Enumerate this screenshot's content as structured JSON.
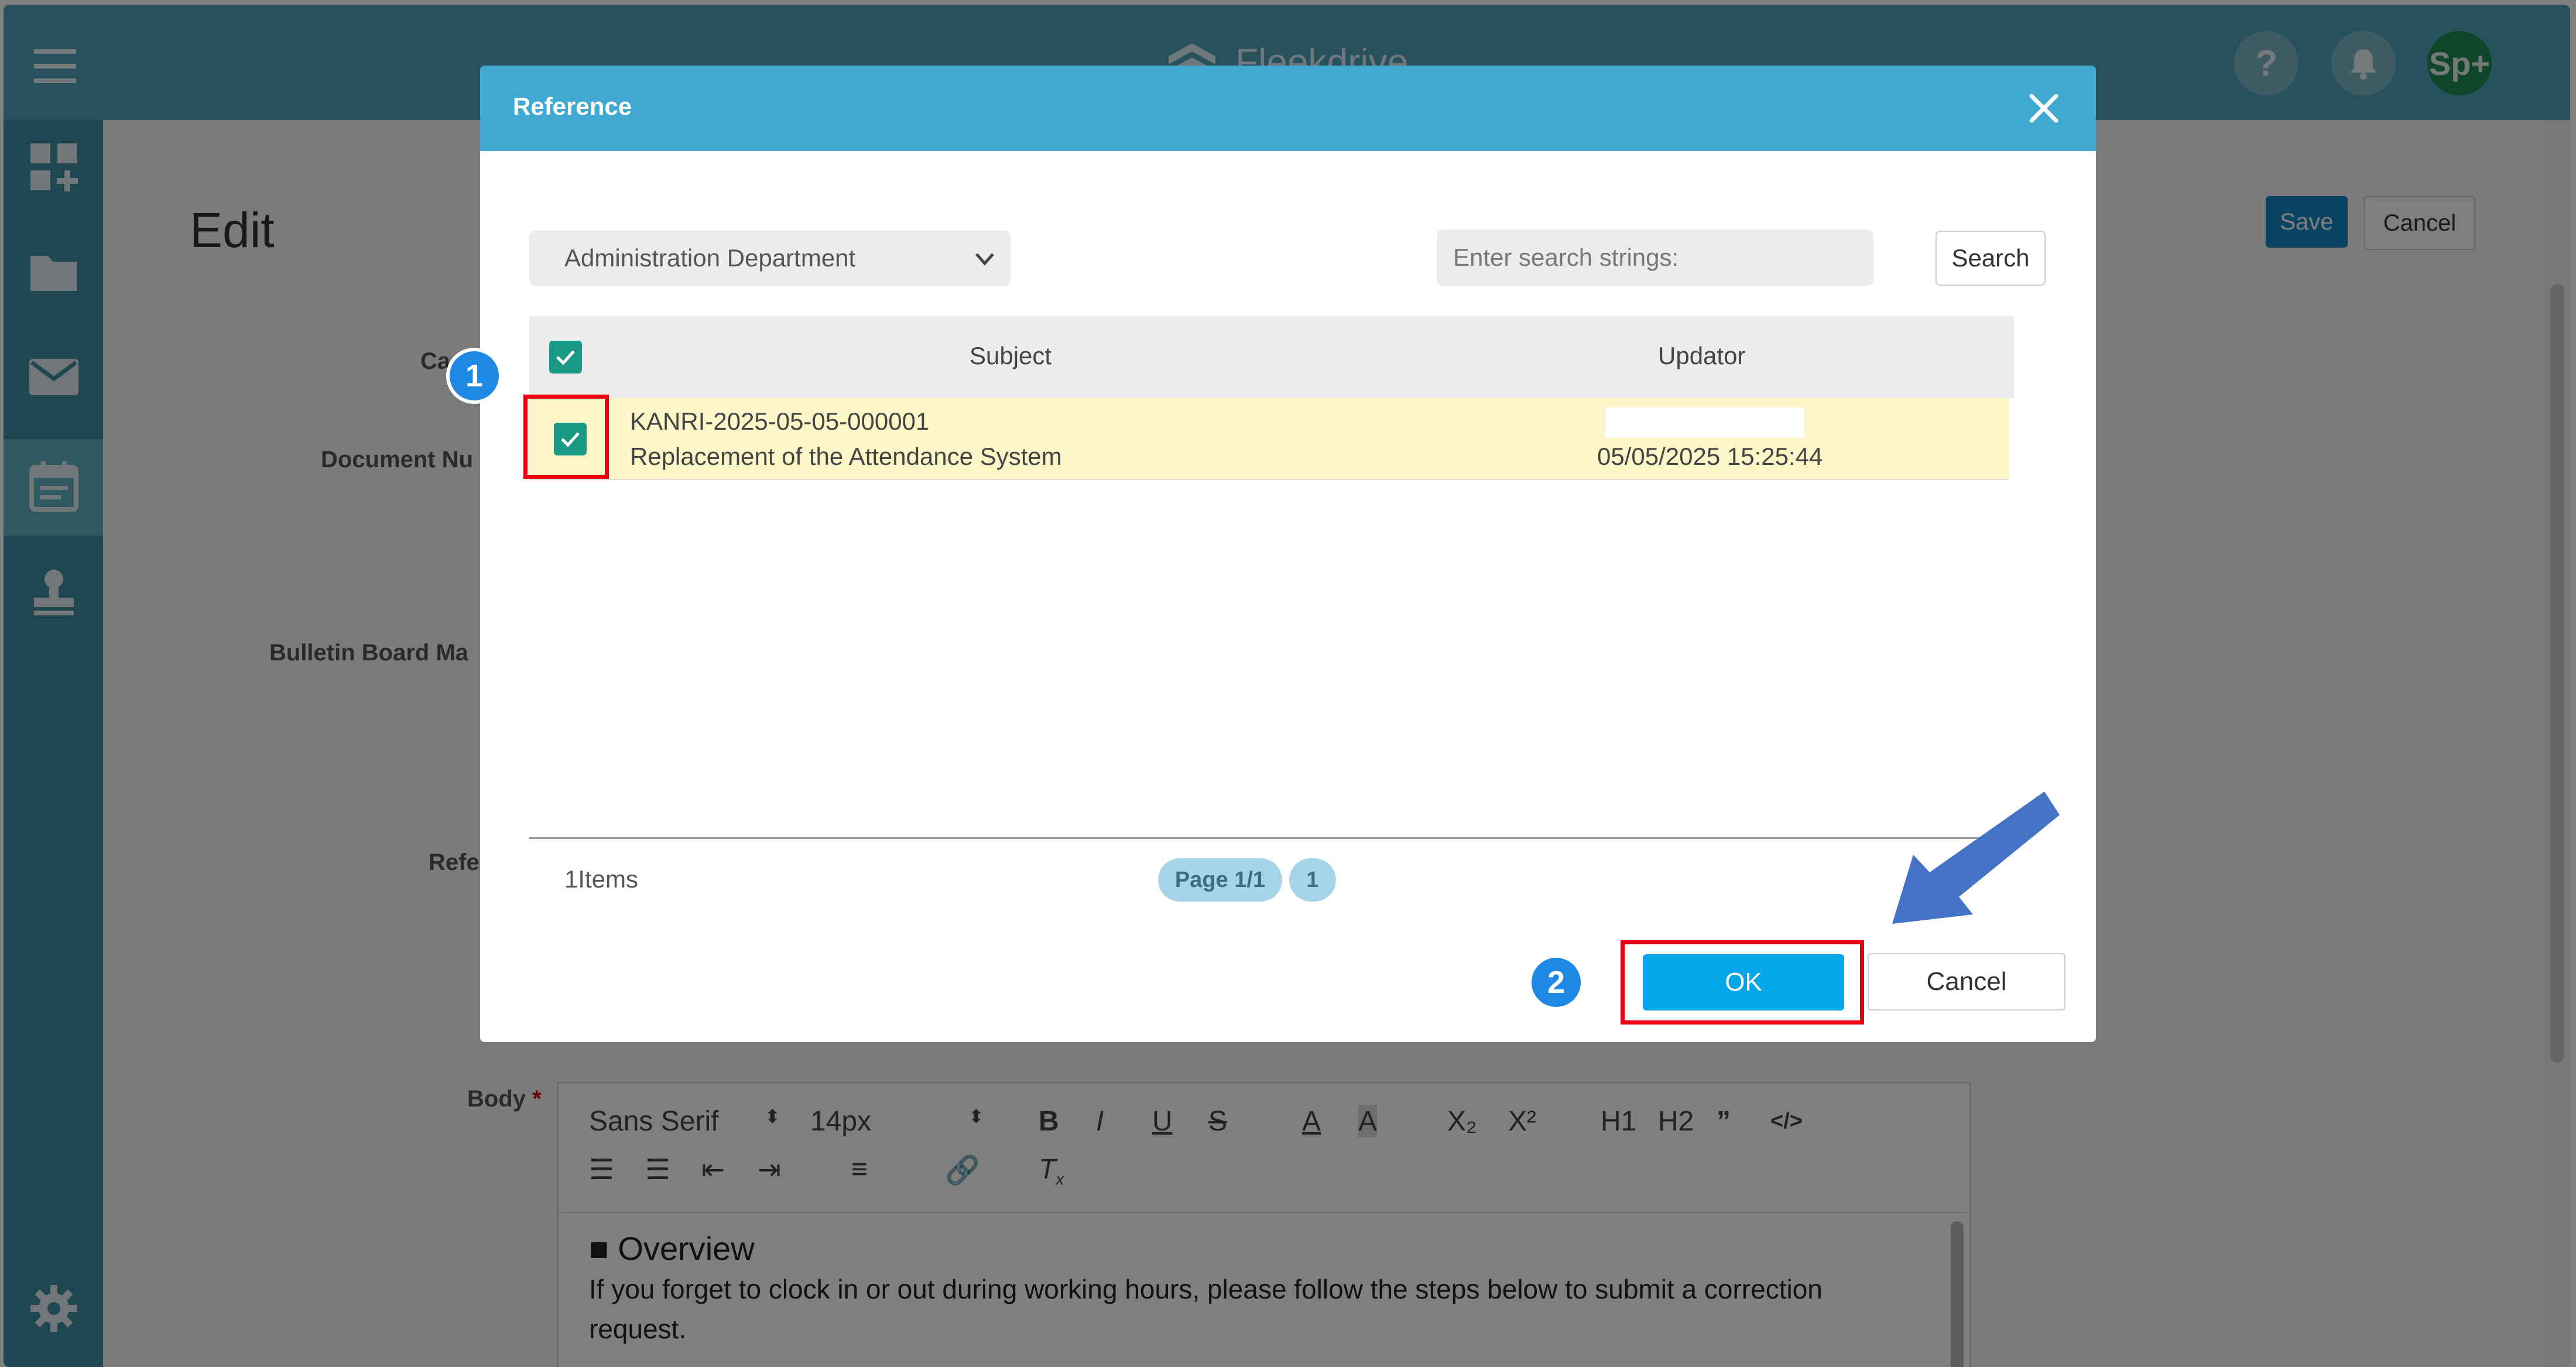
{
  "app": {
    "brand": "Fleekdrive",
    "avatar_text": "Sp+",
    "help_glyph": "?",
    "page_title": "Edit",
    "save_label": "Save",
    "cancel_label": "Cancel",
    "field_labels": [
      "Ca",
      "Document Nu",
      "Bulletin Board Ma",
      "Refe",
      "Body"
    ],
    "required_mark": "*",
    "nav_icons": [
      "dashboard-add-icon",
      "folder-icon",
      "mail-icon",
      "calendar-icon",
      "stamp-icon",
      "gear-icon"
    ]
  },
  "editor": {
    "font_family_value": "Sans Serif",
    "font_size_value": "14px",
    "format_buttons": [
      "B",
      "I",
      "U",
      "S",
      "A",
      "A",
      "X₂",
      "X²",
      "H1",
      "H2",
      "”",
      "</>"
    ],
    "heading": "■ Overview",
    "body_line1": "If you forget to clock in or out during working hours, please follow the steps below to submit a correction",
    "body_line2": "request."
  },
  "modal": {
    "title": "Reference",
    "department_select": "Administration Department",
    "search_placeholder": "Enter search strings:",
    "search_button": "Search",
    "columns": {
      "subject": "Subject",
      "updator": "Updator"
    },
    "rows": [
      {
        "id": "KANRI-2025-05-05-000001",
        "subject": "Replacement of the Attendance System",
        "updated": "05/05/2025 15:25:44",
        "checked": true
      }
    ],
    "items_count": "1Items",
    "page_label": "Page 1/1",
    "page_number": "1",
    "ok_button": "OK",
    "cancel_button": "Cancel"
  },
  "annotations": {
    "step1": "1",
    "step2": "2",
    "highlight_color": "#e60012",
    "arrow_color": "#4472c4"
  }
}
